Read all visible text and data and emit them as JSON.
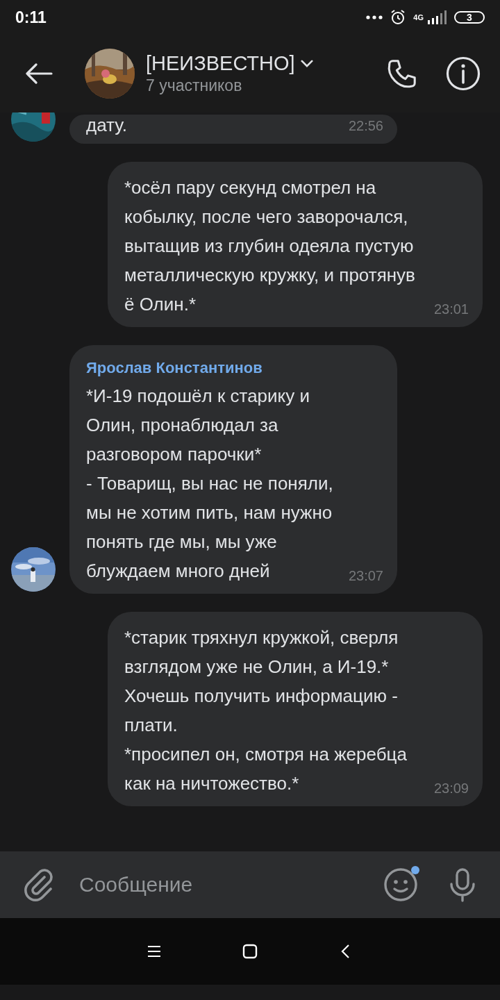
{
  "status_bar": {
    "time": "0:11",
    "network": "4G",
    "battery": "3"
  },
  "header": {
    "title": "[НЕИЗВЕСТНО]",
    "subtitle": "7 участников"
  },
  "messages": [
    {
      "kind": "incoming",
      "text": "дату.",
      "time": "22:56"
    },
    {
      "kind": "outgoing",
      "text": "*осёл пару секунд смотрел на кобылку, после чего заворочался, вытащив из глубин одеяла пустую металлическую кружку, и протянув ё Олин.*",
      "time": "23:01"
    },
    {
      "kind": "incoming",
      "sender": "Ярослав Константинов",
      "text": "*И-19 подошёл к старику и Олин, пронаблюдал за разговором парочки*\n- Товарищ, вы нас не поняли, мы не хотим пить, нам нужно понять где мы, мы уже блуждаем много дней",
      "time": "23:07"
    },
    {
      "kind": "outgoing",
      "text": "*старик тряхнул кружкой, сверля взглядом уже не Олин, а И-19.*\nХочешь получить информацию - плати.\n*просипел он, смотря на жеребца как на ничтожество.*",
      "time": "23:09"
    }
  ],
  "composer": {
    "placeholder": "Сообщение",
    "emoji_badge": true
  }
}
